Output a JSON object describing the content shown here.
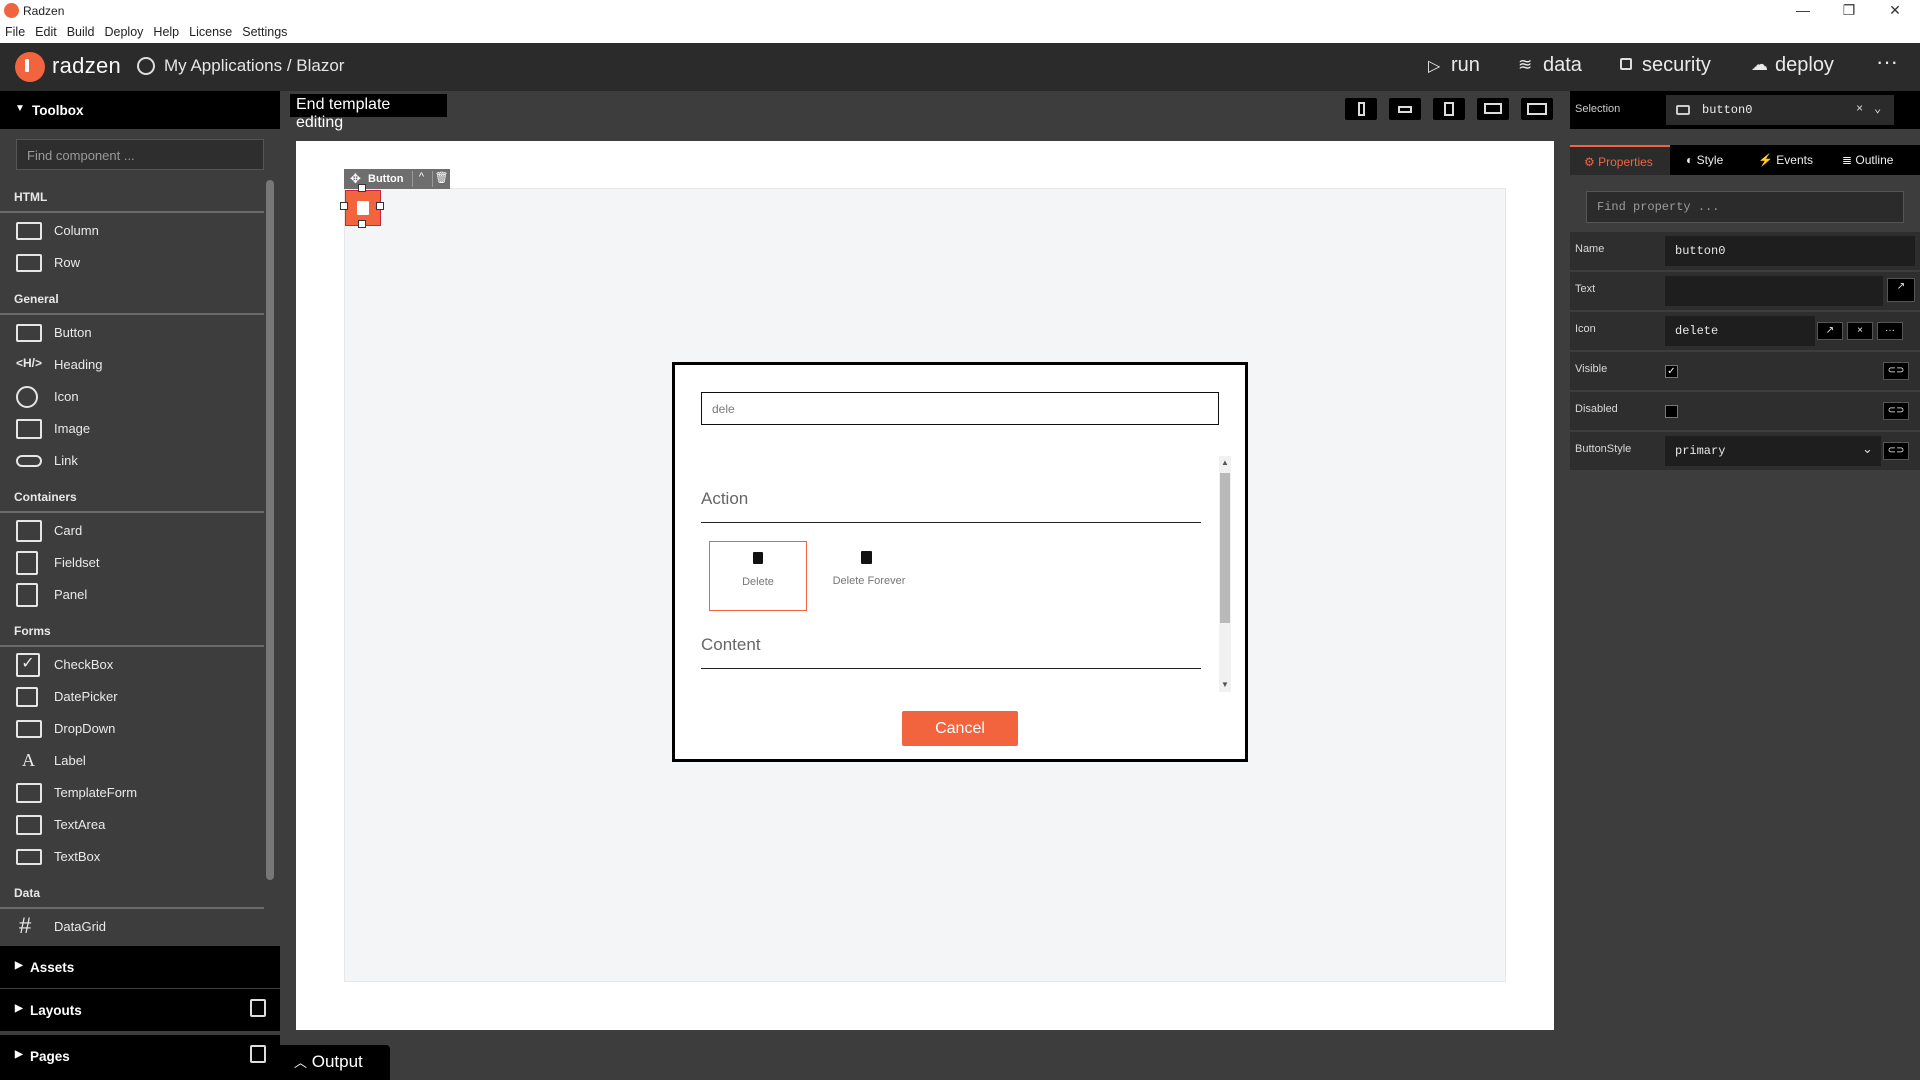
{
  "window": {
    "title": "Radzen",
    "controls": [
      "—",
      "❐",
      "✕"
    ]
  },
  "menu": [
    "File",
    "Edit",
    "Build",
    "Deploy",
    "Help",
    "License",
    "Settings"
  ],
  "header": {
    "brand": "radzen",
    "breadcrumb": "My Applications / Blazor",
    "nav": {
      "run": "run",
      "data": "data",
      "security": "security",
      "deploy": "deploy",
      "more": "···"
    }
  },
  "toolbox": {
    "title": "Toolbox",
    "search_placeholder": "Find component ...",
    "categories": {
      "html": {
        "label": "HTML",
        "items": [
          "Column",
          "Row"
        ]
      },
      "general": {
        "label": "General",
        "items": [
          "Button",
          "Heading",
          "Icon",
          "Image",
          "Link"
        ]
      },
      "containers": {
        "label": "Containers",
        "items": [
          "Card",
          "Fieldset",
          "Panel"
        ]
      },
      "forms": {
        "label": "Forms",
        "items": [
          "CheckBox",
          "DatePicker",
          "DropDown",
          "Label",
          "TemplateForm",
          "TextArea",
          "TextBox"
        ]
      },
      "data": {
        "label": "Data",
        "items": [
          "DataGrid"
        ]
      }
    },
    "bottom": {
      "assets": "Assets",
      "layouts": "Layouts",
      "pages": "Pages"
    }
  },
  "canvas": {
    "end_template": "End template editing",
    "selected_badge": "Button",
    "dialog": {
      "search_value": "dele",
      "sections": [
        "Action",
        "Content"
      ],
      "icons": [
        {
          "label": "Delete"
        },
        {
          "label": "Delete Forever"
        }
      ],
      "cancel": "Cancel"
    },
    "output": "Output"
  },
  "properties": {
    "selection_label": "Selection",
    "selection_value": "button0",
    "tabs": [
      "Properties",
      "Style",
      "Events",
      "Outline"
    ],
    "find_placeholder": "Find property ...",
    "rows": {
      "name": {
        "label": "Name",
        "value": "button0"
      },
      "text": {
        "label": "Text",
        "value": ""
      },
      "icon": {
        "label": "Icon",
        "value": "delete"
      },
      "visible": {
        "label": "Visible",
        "checked": true
      },
      "disabled": {
        "label": "Disabled",
        "checked": false
      },
      "buttonstyle": {
        "label": "ButtonStyle",
        "value": "primary"
      }
    }
  },
  "colors": {
    "accent": "#f2643d",
    "dark": "#000000",
    "panel": "#3d3d3d"
  }
}
